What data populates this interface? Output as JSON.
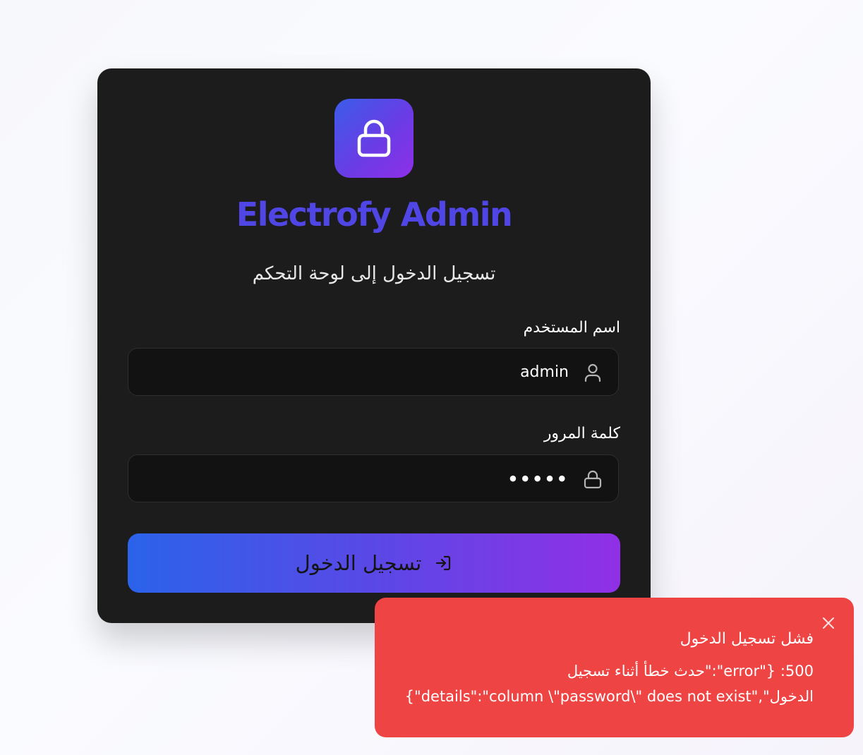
{
  "app": {
    "title": "Electrofy Admin",
    "subtitle": "تسجيل الدخول إلى لوحة التحكم"
  },
  "username": {
    "label": "اسم المستخدم",
    "value": "admin",
    "icon": "user-icon"
  },
  "password": {
    "label": "كلمة المرور",
    "value": "•••••",
    "icon": "lock-icon"
  },
  "login_button": {
    "label": "تسجيل الدخول",
    "icon": "sign-in-icon"
  },
  "toast": {
    "title": "فشل تسجيل الدخول",
    "message_line1": "500: {\"error\":\"حدث خطأ أثناء تسجيل",
    "message_line2": "الدخول\",\"details\":\"column \\\"password\\\" does not exist\"}",
    "close_icon": "close-icon"
  },
  "colors": {
    "card_bg": "#1c1c1c",
    "accent_blue": "#2b63ea",
    "accent_purple": "#9130e6",
    "title": "#5046e5",
    "toast_bg": "#ef4444"
  }
}
